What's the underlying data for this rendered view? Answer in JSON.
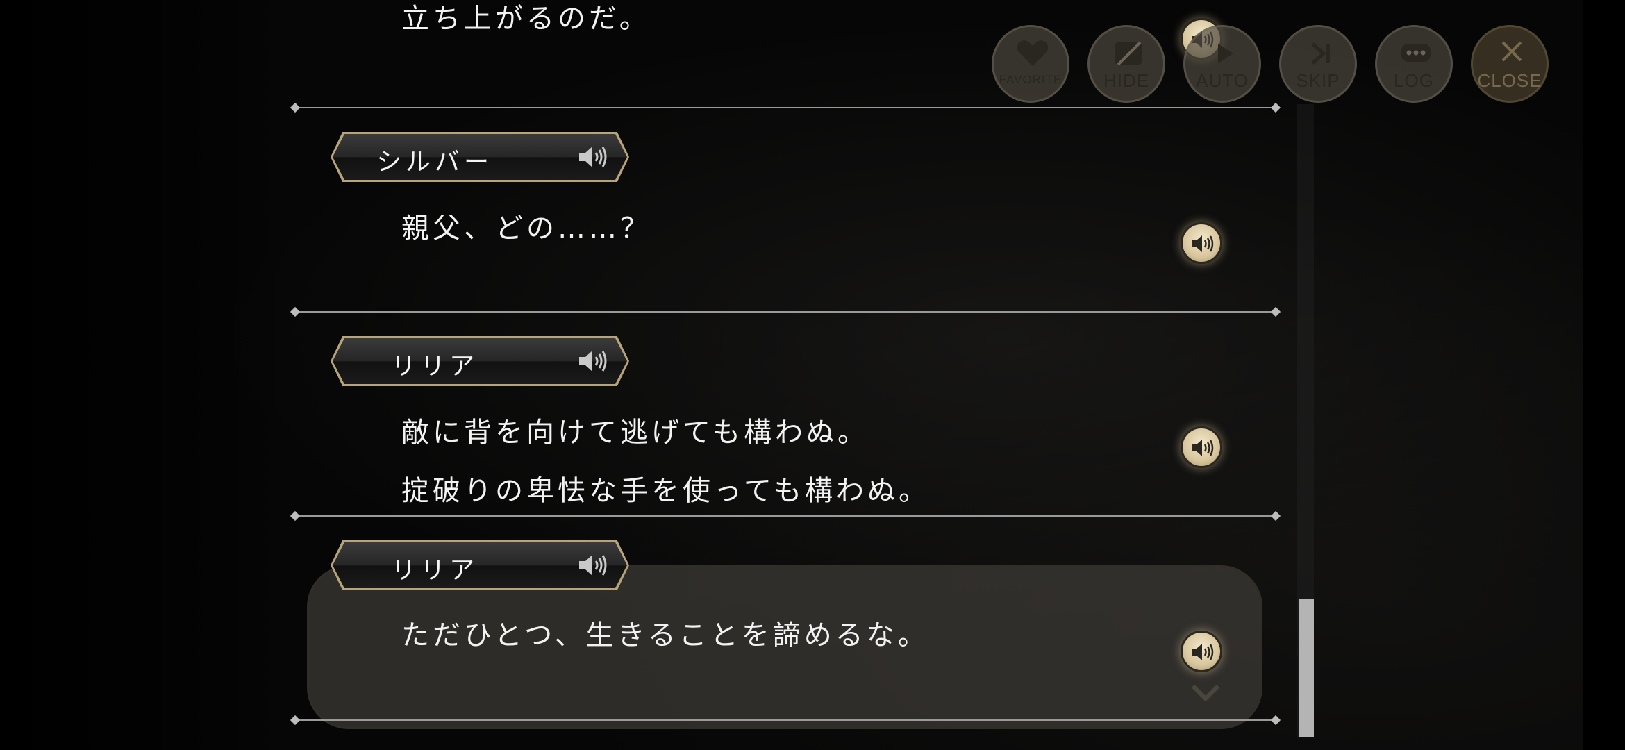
{
  "toolbar": {
    "buttons": [
      {
        "name": "favorite",
        "label": "FAVORITE",
        "icon": "heart-icon"
      },
      {
        "name": "hide",
        "label": "HIDE",
        "icon": "hide-icon"
      },
      {
        "name": "auto",
        "label": "AUTO",
        "icon": "auto-icon"
      },
      {
        "name": "skip",
        "label": "SKIP",
        "icon": "skip-icon"
      },
      {
        "name": "log",
        "label": "LOG",
        "icon": "chat-bubble-icon"
      },
      {
        "name": "close",
        "label": "CLOSE",
        "icon": "close-icon"
      }
    ]
  },
  "log": {
    "partial_line": "立ち上がるのだ。",
    "entries": [
      {
        "speaker": "シルバー",
        "lines": [
          "親父、どの……？"
        ]
      },
      {
        "speaker": "リリア",
        "lines": [
          "敵に背を向けて逃げても構わぬ。",
          "掟破りの卑怯な手を使っても構わぬ。"
        ]
      },
      {
        "speaker": "リリア",
        "lines": [
          "ただひとつ、生きることを諦めるな。"
        ],
        "current": true
      }
    ]
  },
  "colors": {
    "accent_gold": "#d8c69d",
    "text": "#f2f2f2",
    "divider": "#9a9a9a"
  },
  "scrollbar": {
    "position": "bottom"
  }
}
